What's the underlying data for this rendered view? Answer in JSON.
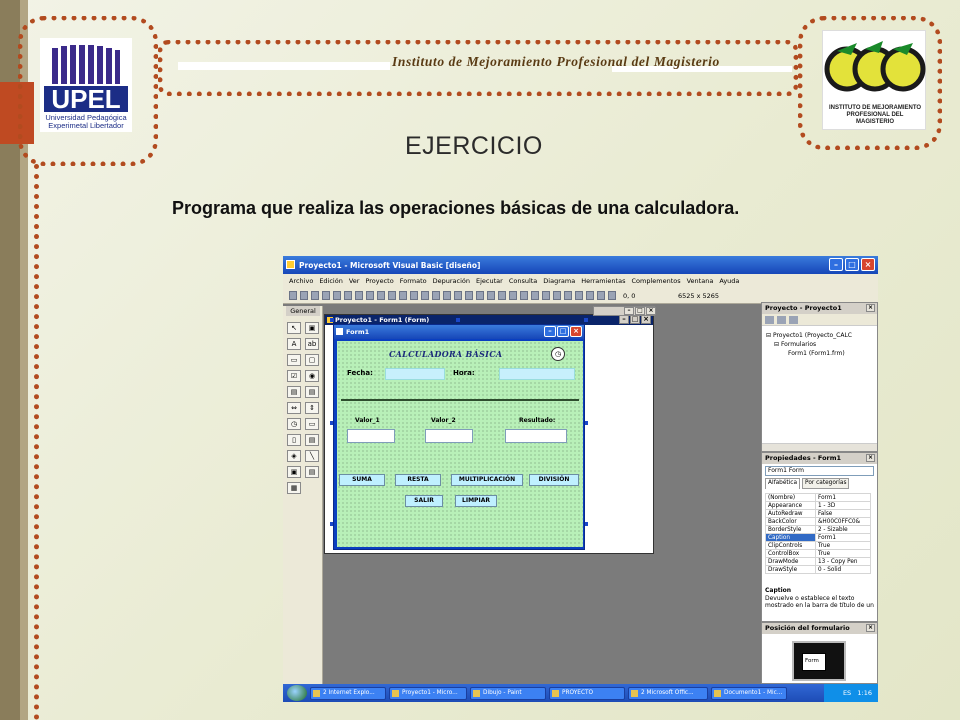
{
  "slide": {
    "title": "Instituto de Mejoramiento Profesional del Magisterio",
    "left_logo": {
      "name": "UPEL",
      "subtitle": "Universidad Pedagógica Experimetal Libertador"
    },
    "right_logo": {
      "caption": "INSTITUTO DE MEJORAMIENTO PROFESIONAL DEL MAGISTERIO"
    },
    "heading": "EJERCICIO",
    "paragraph": "Programa que realiza las operaciones básicas de una calculadora."
  },
  "vb": {
    "window_title": "Proyecto1 - Microsoft Visual Basic [diseño]",
    "menus": [
      "Archivo",
      "Edición",
      "Ver",
      "Proyecto",
      "Formato",
      "Depuración",
      "Ejecutar",
      "Consulta",
      "Diagrama",
      "Herramientas",
      "Complementos",
      "Ventana",
      "Ayuda"
    ],
    "toolbar_coords": "0, 0",
    "toolbar_size": "6525 x 5265",
    "toolbox_title": "General",
    "toolbox_glyphs": [
      "↖",
      "▣",
      "A",
      "ab",
      "▭",
      "▢",
      "☑",
      "◉",
      "▤",
      "▤",
      "⇔",
      "⇕",
      "◷",
      "▭",
      "▯",
      "▤",
      "◈",
      "╲",
      "▣",
      "▤",
      "▦"
    ],
    "designer_title": "Proyecto1 - Form1 (Form)",
    "form": {
      "title": "Form1",
      "calc_title": "CALCULADORA BÁSICA",
      "fecha_label": "Fecha:",
      "hora_label": "Hora:",
      "valor1_label": "Valor_1",
      "valor2_label": "Valor_2",
      "resultado_label": "Resultado:",
      "buttons": {
        "suma": "SUMA",
        "resta": "RESTA",
        "multiplicacion": "MULTIPLICACIÓN",
        "division": "DIVISIÓN",
        "salir": "SALIR",
        "limpiar": "LIMPIAR"
      }
    },
    "project_panel": {
      "title": "Proyecto - Proyecto1",
      "tree": [
        "Proyecto1 (Proyecto_CALC",
        "Formularios",
        "Form1 (Form1.frm)"
      ]
    },
    "properties_panel": {
      "title": "Propiedades - Form1",
      "object": "Form1  Form",
      "tabs": [
        "Alfabética",
        "Por categorías"
      ],
      "rows": [
        {
          "name": "(Nombre)",
          "value": "Form1"
        },
        {
          "name": "Appearance",
          "value": "1 - 3D"
        },
        {
          "name": "AutoRedraw",
          "value": "False"
        },
        {
          "name": "BackColor",
          "value": "&H00C0FFC0&"
        },
        {
          "name": "BorderStyle",
          "value": "2 - Sizable"
        },
        {
          "name": "Caption",
          "value": "Form1"
        },
        {
          "name": "ClipControls",
          "value": "True"
        },
        {
          "name": "ControlBox",
          "value": "True"
        },
        {
          "name": "DrawMode",
          "value": "13 - Copy Pen"
        },
        {
          "name": "DrawStyle",
          "value": "0 - Solid"
        }
      ],
      "desc_title": "Caption",
      "desc_text": "Devuelve o establece el texto mostrado en la barra de título de un"
    },
    "position_panel": {
      "title": "Posición del formulario",
      "form_label": "Form"
    },
    "taskbar": {
      "items": [
        "2 Internet Explo...",
        "Proyecto1 - Micro...",
        "Dibujo - Paint",
        "PROYECTO",
        "2 Microsoft Offic...",
        "Documento1 - Mic..."
      ],
      "lang": "ES",
      "time": "1:16"
    }
  }
}
